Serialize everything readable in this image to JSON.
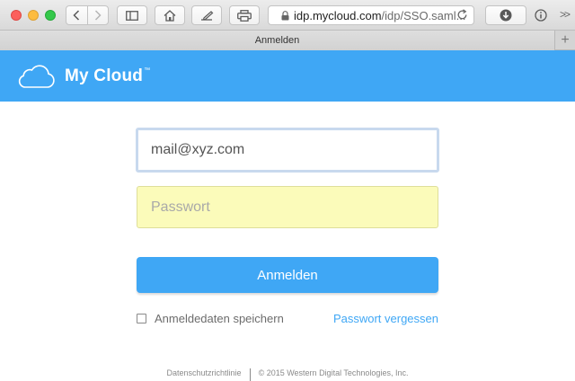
{
  "browser": {
    "address": {
      "host": "idp.mycloud.com",
      "path": "/idp/SSO.saml..."
    },
    "tab": {
      "title": "Anmelden"
    },
    "icons": {
      "back": "chevron-left-icon",
      "forward": "chevron-right-icon",
      "sidebar": "sidebar-icon",
      "home": "home-icon",
      "annotate": "pencil-icon",
      "print": "print-icon",
      "lock": "lock-icon",
      "reload": "reload-icon",
      "downloads": "download-icon",
      "info": "info-icon",
      "more": "chevron-double-right-icon",
      "new_tab": "plus-icon"
    }
  },
  "app": {
    "brand": "My Cloud",
    "trademark": "™",
    "accent_color": "#3fa7f5"
  },
  "login": {
    "email_value": "mail@xyz.com",
    "password_placeholder": "Passwort",
    "password_bg": "#fbfbba",
    "submit_label": "Anmelden",
    "remember_label": "Anmeldedaten speichern",
    "remember_checked": false,
    "forgot_label": "Passwort vergessen"
  },
  "footer": {
    "privacy": "Datenschutzrichtlinie",
    "copyright": "© 2015 Western Digital Technologies, Inc."
  }
}
